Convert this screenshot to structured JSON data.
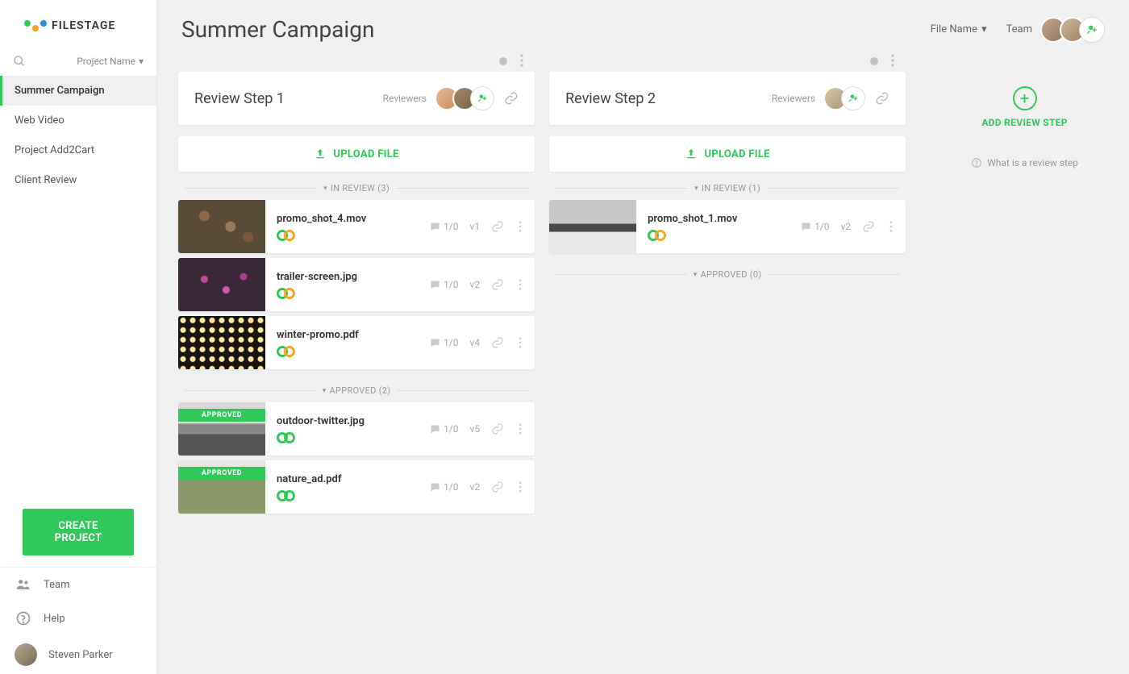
{
  "brand": "FILESTAGE",
  "sidebar": {
    "project_name_label": "Project Name",
    "items": [
      {
        "label": "Summer Campaign",
        "active": true
      },
      {
        "label": "Web Video",
        "active": false
      },
      {
        "label": "Project Add2Cart",
        "active": false
      },
      {
        "label": "Client Review",
        "active": false
      }
    ],
    "create_project": "CREATE PROJECT",
    "team": "Team",
    "help": "Help",
    "user": "Steven Parker"
  },
  "header": {
    "title": "Summer Campaign",
    "file_name_label": "File Name",
    "team_label": "Team"
  },
  "steps": [
    {
      "title": "Review Step 1",
      "reviewers_label": "Reviewers",
      "upload_label": "UPLOAD FILE",
      "sections": [
        {
          "label": "IN REVIEW (3)",
          "files": [
            {
              "name": "promo_shot_4.mov",
              "comments": "1/0",
              "version": "v1",
              "status": "review",
              "thumb": "logs"
            },
            {
              "name": "trailer-screen.jpg",
              "comments": "1/0",
              "version": "v2",
              "status": "review",
              "thumb": "flowers"
            },
            {
              "name": "winter-promo.pdf",
              "comments": "1/0",
              "version": "v4",
              "status": "review",
              "thumb": "lights"
            }
          ]
        },
        {
          "label": "APPROVED (2)",
          "files": [
            {
              "name": "outdoor-twitter.jpg",
              "comments": "1/0",
              "version": "v5",
              "status": "approved",
              "thumb": "outdoor",
              "banner": "APPROVED"
            },
            {
              "name": "nature_ad.pdf",
              "comments": "1/0",
              "version": "v2",
              "status": "approved",
              "thumb": "nature",
              "banner": "APPROVED"
            }
          ]
        }
      ]
    },
    {
      "title": "Review Step 2",
      "reviewers_label": "Reviewers",
      "upload_label": "UPLOAD FILE",
      "sections": [
        {
          "label": "IN REVIEW (1)",
          "files": [
            {
              "name": "promo_shot_1.mov",
              "comments": "1/0",
              "version": "v2",
              "status": "review",
              "thumb": "mountain"
            }
          ]
        },
        {
          "label": "APPROVED (0)",
          "files": []
        }
      ]
    }
  ],
  "add_step": {
    "label": "ADD REVIEW STEP",
    "help": "What is a review step"
  }
}
